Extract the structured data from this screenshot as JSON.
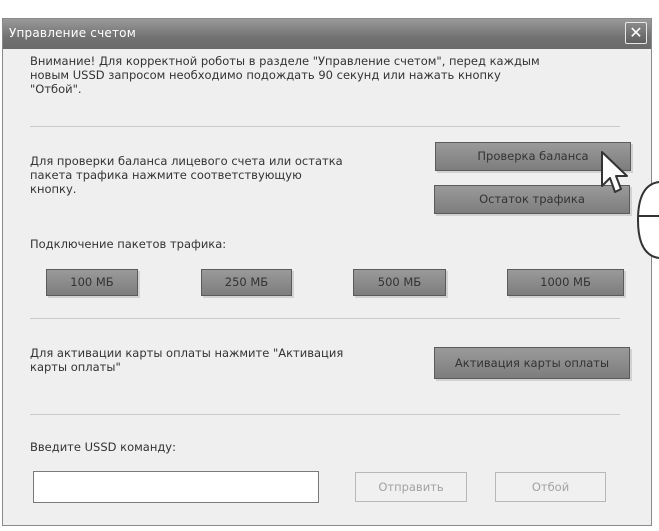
{
  "window": {
    "title": "Управление счетом",
    "close_label": "✕"
  },
  "notice": {
    "line1": "Внимание! Для корректной роботы в разделе \"Управление счетом\", перед каждым",
    "line2": "новым USSD запросом необходимо подождать 90 секунд или нажать кнопку",
    "line3": "\"Отбой\"."
  },
  "balance": {
    "line1": "Для проверки баланса лицевого счета или остатка",
    "line2": "пакета трафика нажмите соответствующую",
    "line3": "кнопку.",
    "check_balance_label": "Проверка баланса",
    "traffic_rest_label": "Остаток трафика"
  },
  "traffic": {
    "heading": "Подключение пакетов трафика:",
    "packages": [
      "100 МБ",
      "250 МБ",
      "500 МБ",
      "1000 МБ"
    ]
  },
  "activation": {
    "line1": "Для активации карты оплаты нажмите \"Активация",
    "line2": "карты оплаты\"",
    "button_label": "Активация карты оплаты"
  },
  "ussd": {
    "label": "Введите USSD команду:",
    "input_value": "",
    "send_label": "Отправить",
    "cancel_label": "Отбой"
  }
}
